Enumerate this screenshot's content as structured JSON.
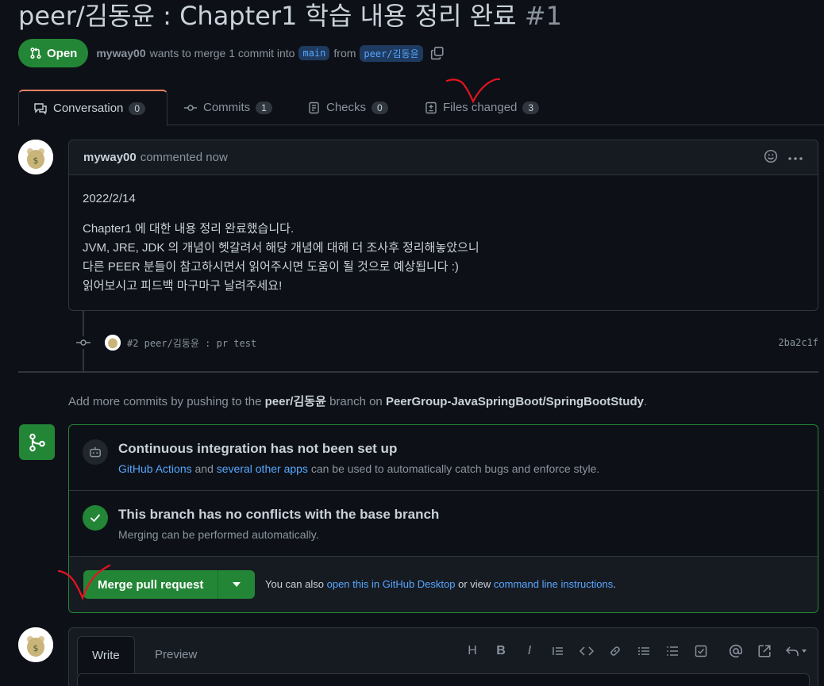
{
  "pr": {
    "title": "peer/김동윤 : Chapter1 학습 내용 정리 완료",
    "number": "#1",
    "status_label": "Open",
    "author": "myway00",
    "merge_text_1": "wants to merge 1 commit into",
    "base_branch": "main",
    "from_text": "from",
    "head_branch": "peer/김동윤"
  },
  "tabs": [
    {
      "label": "Conversation",
      "count": "0"
    },
    {
      "label": "Commits",
      "count": "1"
    },
    {
      "label": "Checks",
      "count": "0"
    },
    {
      "label": "Files changed",
      "count": "3"
    }
  ],
  "comment": {
    "author": "myway00",
    "meta": "commented now",
    "date_line": "2022/2/14",
    "lines": [
      "Chapter1 에 대한 내용 정리 완료했습니다.",
      "JVM, JRE, JDK 의 개념이 헷갈려서 해당 개념에 대해 더 조사후 정리해놓았으니",
      "다른 PEER 분들이 참고하시면서 읽어주시면 도움이 될 것으로 예상됩니다 :)",
      "읽어보시고 피드백 마구마구 날려주세요!"
    ]
  },
  "commit": {
    "message": "#2 peer/김동윤 : pr test",
    "sha": "2ba2c1f"
  },
  "push_hint": {
    "prefix": "Add more commits by pushing to the",
    "branch": "peer/김동윤",
    "middle": "branch on",
    "repo": "PeerGroup-JavaSpringBoot/SpringBootStudy",
    "suffix": "."
  },
  "merge_box": {
    "ci_title": "Continuous integration has not been set up",
    "ci_link1": "GitHub Actions",
    "ci_and": "and",
    "ci_link2": "several other apps",
    "ci_rest": "can be used to automatically catch bugs and enforce style.",
    "nc_title": "This branch has no conflicts with the base branch",
    "nc_sub": "Merging can be performed automatically.",
    "merge_button": "Merge pull request",
    "note_prefix": "You can also",
    "note_link1": "open this in GitHub Desktop",
    "note_mid": "or view",
    "note_link2": "command line instructions",
    "note_suffix": "."
  },
  "editor": {
    "tab_write": "Write",
    "tab_preview": "Preview",
    "tb_heading": "H",
    "tb_bold": "B",
    "tb_italic": "I"
  },
  "colors": {
    "background": "#0d1117",
    "accent_green": "#238636",
    "link_blue": "#58a6ff",
    "annotation_red": "#e5141f"
  }
}
